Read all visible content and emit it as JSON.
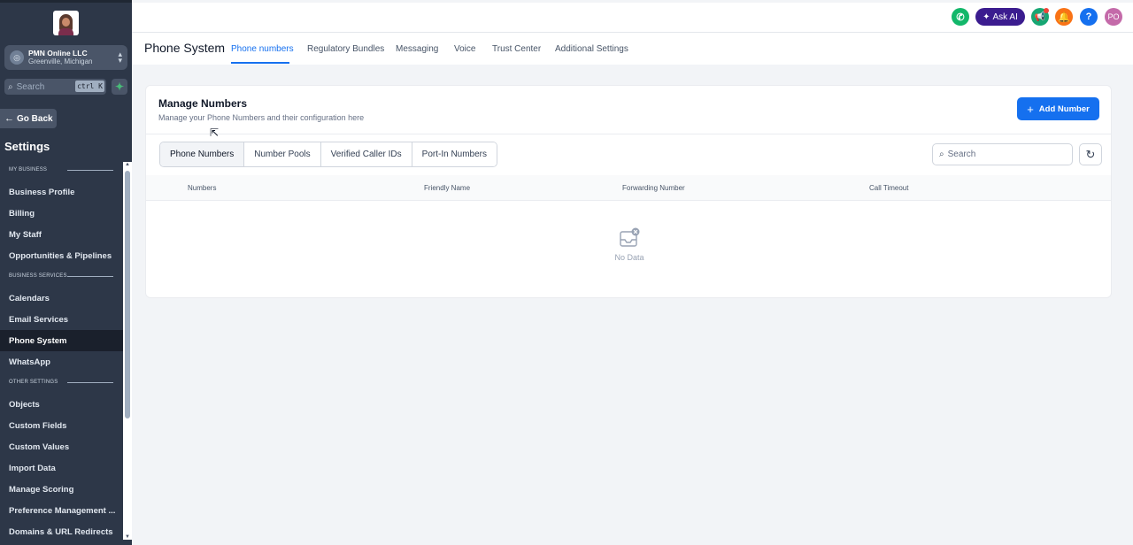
{
  "sidebar": {
    "account": {
      "name": "PMN Online LLC",
      "location": "Greenville, Michigan"
    },
    "search": {
      "label": "Search",
      "shortcut": "ctrl K"
    },
    "go_back": "Go Back",
    "settings_title": "Settings",
    "sections": [
      {
        "title": "MY BUSINESS",
        "items": [
          "Business Profile",
          "Billing",
          "My Staff",
          "Opportunities & Pipelines"
        ]
      },
      {
        "title": "BUSINESS SERVICES",
        "items": [
          "Calendars",
          "Email Services",
          "Phone System",
          "WhatsApp"
        ]
      },
      {
        "title": "OTHER SETTINGS",
        "items": [
          "Objects",
          "Custom Fields",
          "Custom Values",
          "Import Data",
          "Manage Scoring",
          "Preference Management ...",
          "Domains & URL Redirects"
        ]
      }
    ],
    "active_item": "Phone System"
  },
  "topbar": {
    "ask_ai": "Ask AI",
    "avatar_initials": "PO"
  },
  "subnav": {
    "page_title": "Phone System",
    "tabs": [
      "Phone numbers",
      "Regulatory Bundles",
      "Messaging",
      "Voice",
      "Trust Center",
      "Additional Settings"
    ],
    "active_tab": "Phone numbers"
  },
  "card": {
    "title": "Manage Numbers",
    "subtitle": "Manage your Phone Numbers and their configuration here",
    "add_button": "Add Number",
    "segments": [
      "Phone Numbers",
      "Number Pools",
      "Verified Caller IDs",
      "Port-In Numbers"
    ],
    "active_segment": "Phone Numbers",
    "search_placeholder": "Search",
    "columns": [
      "Numbers",
      "Friendly Name",
      "Forwarding Number",
      "Call Timeout"
    ],
    "empty_text": "No Data"
  },
  "colors": {
    "accent": "#1570ef",
    "sidebar_bg": "#2d3748",
    "ask_ai_bg": "#3b1c8f"
  }
}
